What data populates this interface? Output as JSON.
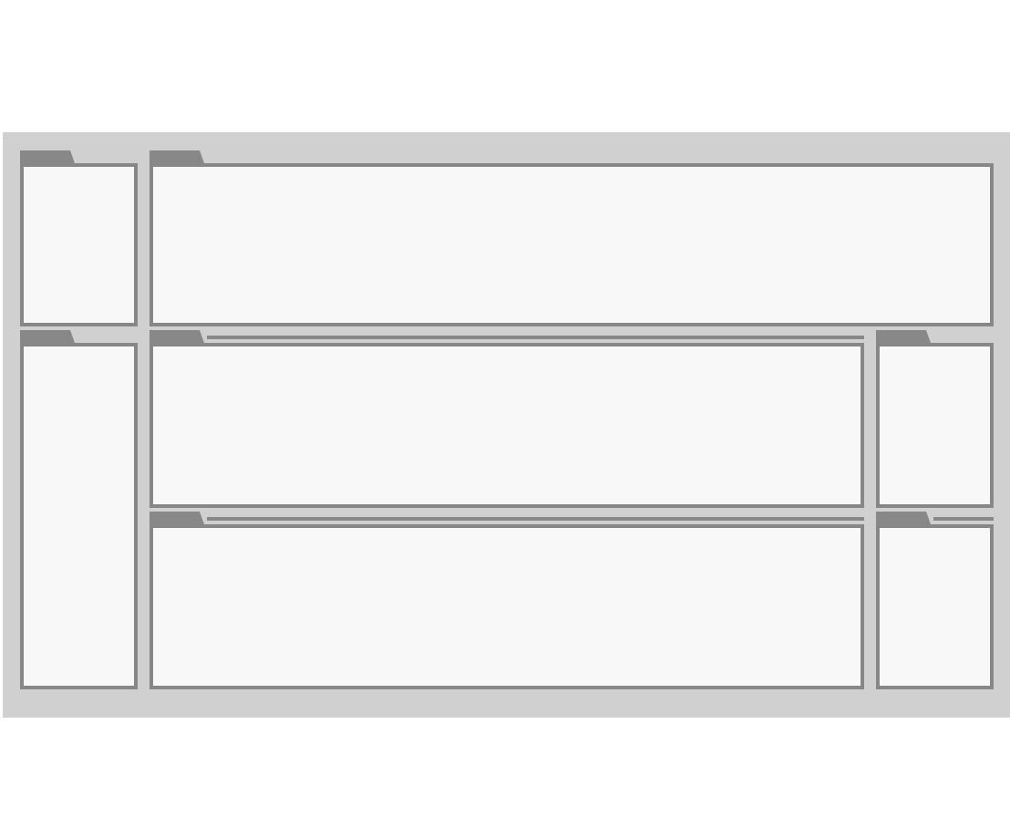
{
  "panels": [
    {
      "kind": "folder"
    },
    {
      "kind": "folder"
    },
    {
      "kind": "folder"
    },
    {
      "kind": "ruled-folder"
    },
    {
      "kind": "folder"
    },
    {
      "kind": "ruled-folder"
    },
    {
      "kind": "ruled-folder"
    }
  ]
}
